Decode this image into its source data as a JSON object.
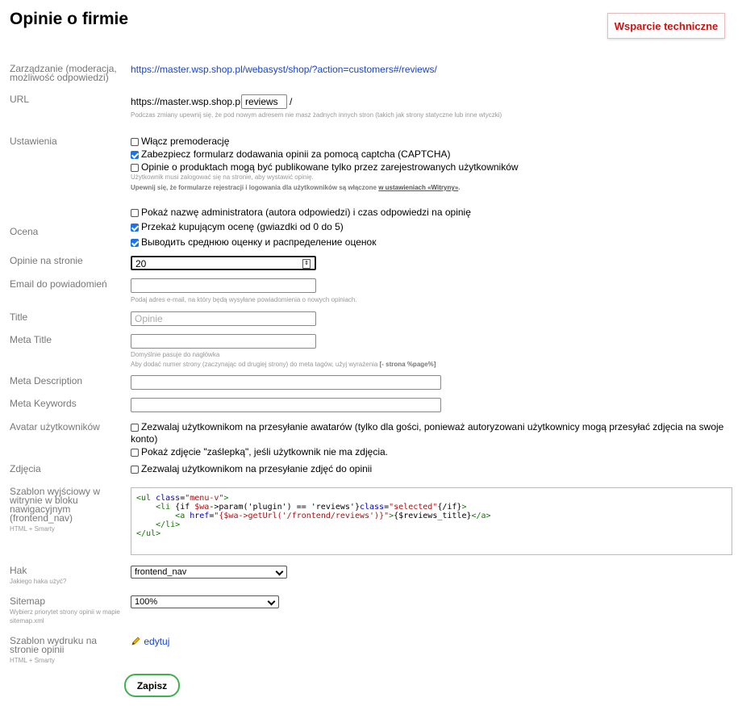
{
  "page": {
    "title": "Opinie o firmie",
    "support_label": "Wsparcie techniczne"
  },
  "management": {
    "label": "Zarządzanie (moderacja, możliwość odpowiedzi)",
    "url": "https://master.wsp.shop.pl/webasyst/shop/?action=customers#/reviews/"
  },
  "url": {
    "label": "URL",
    "prefix": "https://master.wsp.shop.pl/",
    "value": "reviews",
    "suffix": "/",
    "hint": "Podczas zmiany upewnij się, że pod nowym adresem nie masz żadnych innych stron (takich jak strony statyczne lub inne wtyczki)"
  },
  "settings": {
    "label": "Ustawienia",
    "premoderation": "Włącz premoderację",
    "captcha": "Zabezpiecz formularz dodawania opinii za pomocą captcha (CAPTCHA)",
    "registered_only": "Opinie o produktach mogą być publikowane tylko przez zarejestrowanych użytkowników",
    "registered_hint": "Użytkownik musi zalogować się na stronie, aby wystawić opinię.",
    "ensure_prefix": "Upewnij się, że formularze rejestracji i logowania dla użytkowników są włączone ",
    "ensure_link": "w ustawieniach «Witryny»",
    "ensure_suffix": ".",
    "show_admin": "Pokaż nazwę administratora (autora odpowiedzi) i czas odpowiedzi na opinię"
  },
  "rating": {
    "label": "Ocena",
    "pass_rating": "Przekaż kupującym ocenę (gwiazdki od 0 do 5)",
    "show_avg": "Выводить среднюю оценку и распределение оценок"
  },
  "per_page": {
    "label": "Opinie na stronie",
    "value": "20"
  },
  "email": {
    "label": "Email do powiadomień",
    "hint": "Podaj adres e-mail, na który będą wysyłane powiadomienia o nowych opiniach."
  },
  "title_field": {
    "label": "Title",
    "placeholder": "Opinie"
  },
  "meta_title": {
    "label": "Meta Title",
    "hint1": "Domyślnie pasuje do nagłówka",
    "hint2": "Aby dodać numer strony (zaczynając od drugiej strony) do meta tagów, użyj wyrażenia ",
    "hint2_bold": "[- strona %page%]"
  },
  "meta_description": {
    "label": "Meta Description"
  },
  "meta_keywords": {
    "label": "Meta Keywords"
  },
  "avatar": {
    "label": "Avatar użytkowników",
    "allow_upload": "Zezwalaj użytkownikom na przesyłanie awatarów (tylko dla gości, ponieważ autoryzowani użytkownicy mogą przesyłać zdjęcia na swoje konto)",
    "show_placeholder": "Pokaż zdjęcie \"zaślepką\", jeśli użytkownik nie ma zdjęcia."
  },
  "photos": {
    "label": "Zdjęcia",
    "allow_upload": "Zezwalaj użytkownikom na przesyłanie zdjęć do opinii"
  },
  "nav_template": {
    "label": "Szablon wyjściowy w witrynie w bloku nawigacyjnym (frontend_nav)",
    "sub": "HTML + Smarty"
  },
  "hook": {
    "label": "Hak",
    "sub": "Jakiego haka użyć?",
    "value": "frontend_nav"
  },
  "sitemap": {
    "label": "Sitemap",
    "sub": "Wybierz priorytet strony opinii w mapie sitemap.xml",
    "value": "100%"
  },
  "print_template": {
    "label": "Szablon wydruku na stronie opinii",
    "sub": "HTML + Smarty",
    "edit_label": "edytuj"
  },
  "save_label": "Zapisz",
  "colors": {
    "link": "#1a44c8",
    "support": "#d01010",
    "save_border": "#3cb34a",
    "checkbox": "#1a73e8"
  }
}
